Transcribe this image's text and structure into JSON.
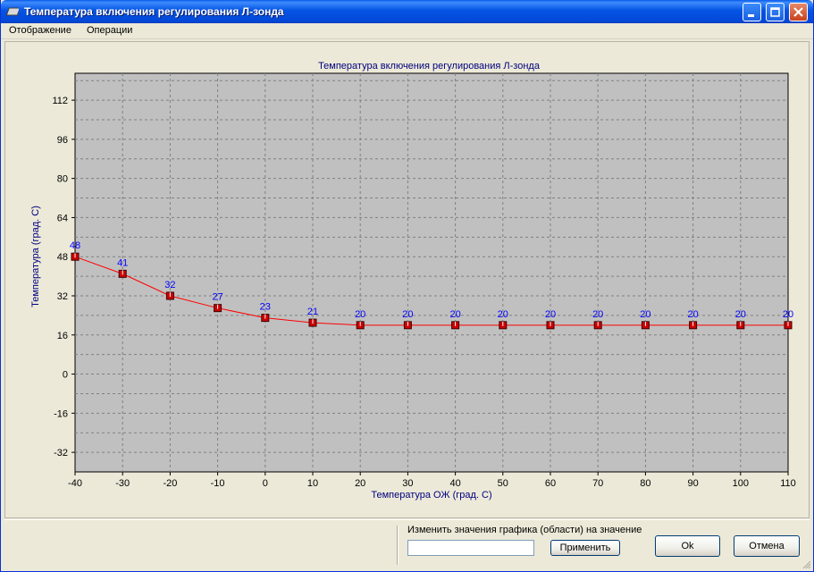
{
  "window": {
    "title": "Температура включения регулирования Л-зонда"
  },
  "menu": {
    "items": [
      "Отображение",
      "Операции"
    ]
  },
  "chart_data": {
    "type": "line",
    "title": "Температура включения регулирования Л-зонда",
    "xlabel": "Температура ОЖ (град. С)",
    "ylabel": "Температура (град. С)",
    "x": [
      -40,
      -30,
      -20,
      -10,
      0,
      10,
      20,
      30,
      40,
      50,
      60,
      70,
      80,
      90,
      100,
      110
    ],
    "values": [
      48,
      41,
      32,
      27,
      23,
      21,
      20,
      20,
      20,
      20,
      20,
      20,
      20,
      20,
      20,
      20
    ],
    "xlim": [
      -40,
      110
    ],
    "ylim": [
      -40,
      123
    ],
    "xticks": [
      -40,
      -30,
      -20,
      -10,
      0,
      10,
      20,
      30,
      40,
      50,
      60,
      70,
      80,
      90,
      100,
      110
    ],
    "yticks": [
      112,
      96,
      80,
      64,
      48,
      32,
      16,
      0,
      -16,
      -32
    ],
    "grid": true,
    "colors": {
      "plot_bg": "#c0c0c0",
      "line": "#ff0000",
      "marker": "#cc0000",
      "label": "#0000ff",
      "axis_title": "#000080"
    }
  },
  "footer": {
    "change_label": "Изменить значения графика (области) на значение",
    "input_value": "",
    "apply_label": "Применить",
    "ok_label": "Ok",
    "cancel_label": "Отмена"
  },
  "icons": {
    "app": "app-icon",
    "minimize": "minimize-icon",
    "maximize": "maximize-icon",
    "close": "close-icon"
  }
}
